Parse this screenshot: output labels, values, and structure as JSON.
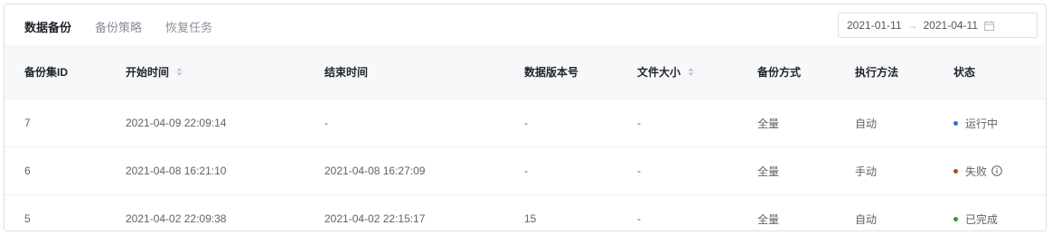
{
  "tabs": [
    {
      "label": "数据备份",
      "active": true
    },
    {
      "label": "备份策略",
      "active": false
    },
    {
      "label": "恢复任务",
      "active": false
    }
  ],
  "date_range": {
    "start": "2021-01-11",
    "separator": "→",
    "end": "2021-04-11",
    "icon": "calendar-icon"
  },
  "table": {
    "columns": [
      {
        "label": "备份集ID",
        "sortable": false
      },
      {
        "label": "开始时间",
        "sortable": true
      },
      {
        "label": "结束时间",
        "sortable": false
      },
      {
        "label": "数据版本号",
        "sortable": false
      },
      {
        "label": "文件大小",
        "sortable": true
      },
      {
        "label": "备份方式",
        "sortable": false
      },
      {
        "label": "执行方法",
        "sortable": false
      },
      {
        "label": "状态",
        "sortable": false
      }
    ],
    "rows": [
      {
        "id": "7",
        "start": "2021-04-09 22:09:14",
        "end": "-",
        "version": "-",
        "size": "-",
        "method": "全量",
        "exec": "自动",
        "status": "运行中",
        "status_color": "#2f6fd6",
        "info": false
      },
      {
        "id": "6",
        "start": "2021-04-08 16:21:10",
        "end": "2021-04-08 16:27:09",
        "version": "-",
        "size": "-",
        "method": "全量",
        "exec": "手动",
        "status": "失败",
        "status_color": "#b5492a",
        "info": true
      },
      {
        "id": "5",
        "start": "2021-04-02 22:09:38",
        "end": "2021-04-02 22:15:17",
        "version": "15",
        "size": "-",
        "method": "全量",
        "exec": "自动",
        "status": "已完成",
        "status_color": "#3f8f3f",
        "info": false
      }
    ]
  }
}
